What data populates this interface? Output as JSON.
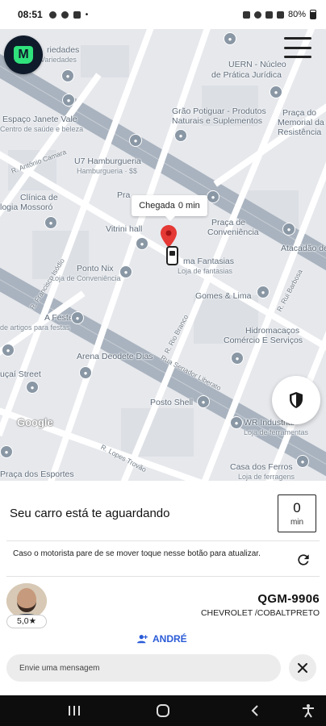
{
  "status_bar": {
    "time": "08:51",
    "battery": "80%"
  },
  "map": {
    "places": [
      {
        "text": "riedades"
      },
      {
        "text": "Variedades"
      },
      {
        "text": "UERN - Núcleo"
      },
      {
        "text": "de Prática Jurídica"
      },
      {
        "text": "Espaço Janete Vale"
      },
      {
        "text": "Centro de saúde e beleza"
      },
      {
        "text": "Grão Potiguar - Produtos"
      },
      {
        "text": "Naturais e Suplementos"
      },
      {
        "text": "Praça do"
      },
      {
        "text": "Memorial da"
      },
      {
        "text": "Resistência"
      },
      {
        "text": "R. Antônio Camara"
      },
      {
        "text": "U7 Hamburgueria"
      },
      {
        "text": "Hamburgueria · $$"
      },
      {
        "text": "Clínica de"
      },
      {
        "text": "logia Mossoró"
      },
      {
        "text": "Pra"
      },
      {
        "text": "Praça de"
      },
      {
        "text": "Conveniência"
      },
      {
        "text": "Vitrini hall"
      },
      {
        "text": "Atacadão de"
      },
      {
        "text": "Ponto Nix"
      },
      {
        "text": "Loja de Conveniência"
      },
      {
        "text": "ma Fantasias"
      },
      {
        "text": "Loja de fantasias"
      },
      {
        "text": "R. Francisco Isódio"
      },
      {
        "text": "Gomes & Lima"
      },
      {
        "text": "R. Rui Barbosa"
      },
      {
        "text": "A Feste"
      },
      {
        "text": "de artigos para festas"
      },
      {
        "text": "Hidromacaços"
      },
      {
        "text": "Comércio E Serviços"
      },
      {
        "text": "R. Rio Branco"
      },
      {
        "text": "Arena Deodete Dias"
      },
      {
        "text": "Rua Senador Liberato"
      },
      {
        "text": "uçaí Street"
      },
      {
        "text": "Posto Shell"
      },
      {
        "text": "WR Industrial"
      },
      {
        "text": "Loja de ferramentas"
      },
      {
        "text": "R. Lopes Trovão"
      },
      {
        "text": "Casa dos Ferros"
      },
      {
        "text": "Loja de ferragens"
      },
      {
        "text": "Praça dos Esportes"
      }
    ],
    "eta_label": "Chegada",
    "eta_value": "0 min",
    "attribution": "Google"
  },
  "sheet": {
    "status_title": "Seu carro está te aguardando",
    "minutes_value": "0",
    "minutes_unit": "min",
    "refresh_text": "Caso o motorista pare de se mover toque nesse botão para atualizar.",
    "rating": "5,0",
    "plate": "QGM-9906",
    "vehicle": "CHEVROLET /COBALTPRETO",
    "driver_name": "ANDRÉ",
    "message_placeholder": "Envie uma mensagem"
  },
  "icons": {
    "menu": "hamburger-menu-icon",
    "shield": "shield-icon",
    "refresh": "refresh-icon",
    "person": "person-icon",
    "close": "close-icon",
    "star": "star-icon",
    "pin": "location-pin-icon",
    "car": "car-icon"
  },
  "colors": {
    "accent_blue": "#2a5bd7",
    "pin_red": "#e53935",
    "logo_green": "#2fe27c",
    "logo_navy": "#0f1b2b"
  }
}
